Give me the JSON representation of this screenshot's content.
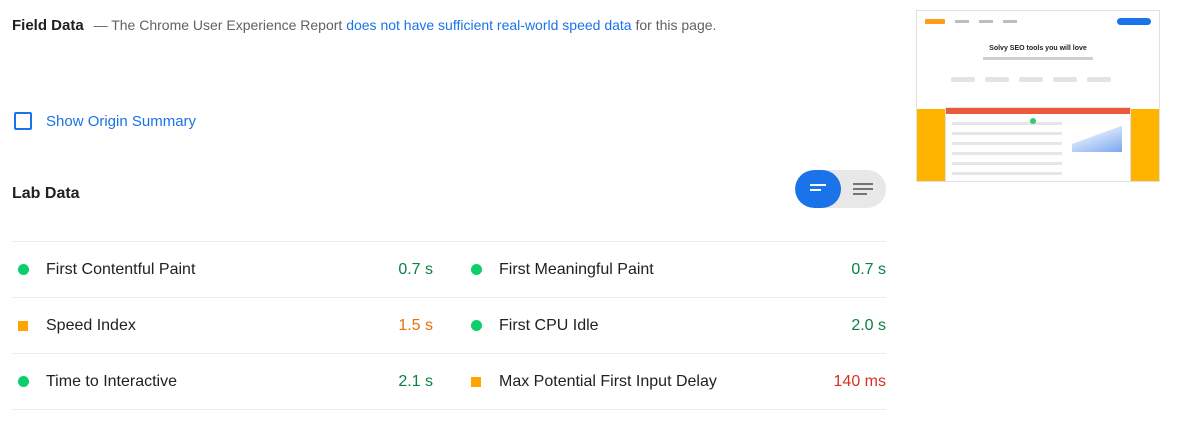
{
  "field_data": {
    "label": "Field Data",
    "prefix": "— The Chrome User Experience Report",
    "link": "does not have sufficient real-world speed data",
    "suffix": "for this page."
  },
  "origin_summary": {
    "label": "Show Origin Summary",
    "checked": false
  },
  "lab_data": {
    "title": "Lab Data",
    "view_toggle": {
      "active": "summary"
    },
    "metrics": [
      {
        "name": "First Contentful Paint",
        "value": "0.7 s",
        "status": "pass"
      },
      {
        "name": "First Meaningful Paint",
        "value": "0.7 s",
        "status": "pass"
      },
      {
        "name": "Speed Index",
        "value": "1.5 s",
        "status": "average"
      },
      {
        "name": "First CPU Idle",
        "value": "2.0 s",
        "status": "pass"
      },
      {
        "name": "Time to Interactive",
        "value": "2.1 s",
        "status": "pass"
      },
      {
        "name": "Max Potential First Input Delay",
        "value": "140 ms",
        "status": "average"
      }
    ]
  },
  "thumbnail": {
    "headline": "Solvy SEO tools you will love"
  },
  "colors": {
    "pass": "#0cce6b",
    "average": "#ffa400",
    "link": "#1a73e8"
  }
}
